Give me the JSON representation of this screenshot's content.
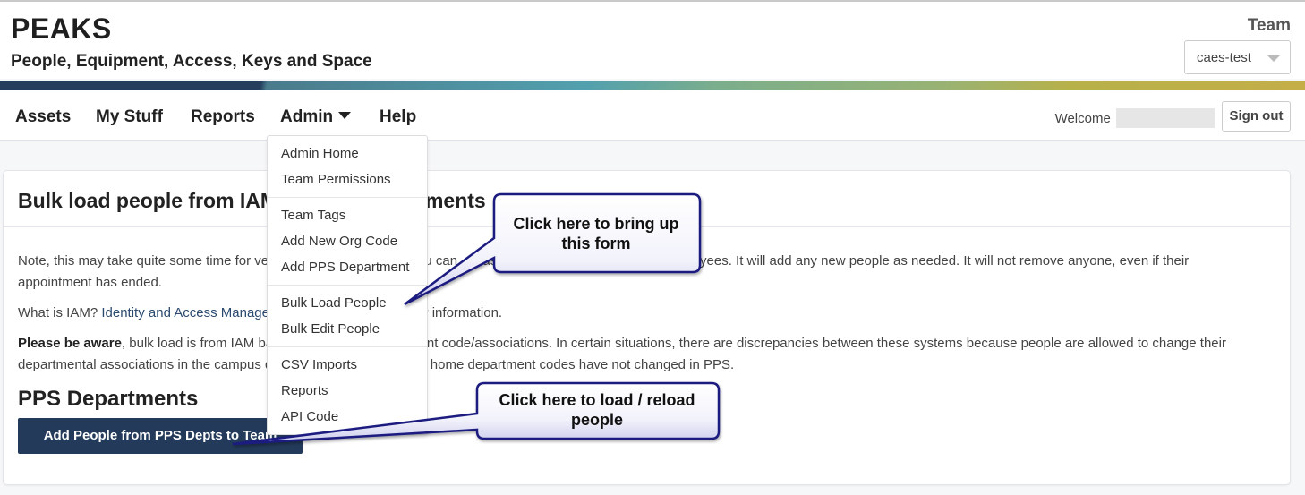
{
  "header": {
    "brand_title": "PEAKS",
    "brand_subtitle": "People, Equipment, Access, Keys and Space",
    "team_label": "Team",
    "team_select_value": "caes-test"
  },
  "nav": {
    "items": [
      {
        "label": "Assets"
      },
      {
        "label": "My Stuff"
      },
      {
        "label": "Reports"
      },
      {
        "label": "Admin"
      },
      {
        "label": "Help"
      }
    ],
    "welcome_label": "Welcome",
    "signout_label": "Sign out"
  },
  "admin_menu": {
    "items": [
      {
        "label": "Admin Home"
      },
      {
        "label": "Team Permissions"
      },
      {
        "label": "Team Tags"
      },
      {
        "label": "Add New Org Code"
      },
      {
        "label": "Add PPS Department"
      },
      {
        "label": "Bulk Load People"
      },
      {
        "label": "Bulk Edit People"
      },
      {
        "label": "CSV Imports"
      },
      {
        "label": "Reports"
      },
      {
        "label": "API Code"
      }
    ]
  },
  "card": {
    "title": "Bulk load people from IAM by PPS Departments",
    "note_text": "Note, this may take quite some time for very large departments. If you can, please do it for smaller groups of employees. It will add any new people as needed. It will not remove anyone, even if their appointment has ended.",
    "iam_question": "What is IAM? ",
    "iam_link": "Identity and Access Management",
    "iam_rest": " is the source for user information.",
    "aware_bold": "Please be aware",
    "aware_text": ", bulk load is from IAM based on the PPS department code/associations. In certain situations, there are discrepancies between these systems because people are allowed to change their departmental associations in the campus directory, even though their home department codes have not changed in PPS.",
    "section_title": "PPS Departments",
    "primary_button_label": "Add People from PPS Depts to Team"
  },
  "callouts": {
    "form_callout": "Click here to bring up this form",
    "load_callout": "Click here to load / reload people"
  },
  "colors": {
    "primary": "#233a5a",
    "callout_border": "#1a1a80",
    "link": "#2b4a6f"
  }
}
